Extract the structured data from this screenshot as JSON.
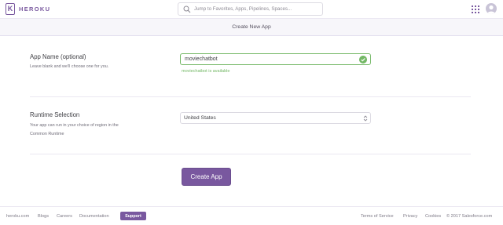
{
  "brand": {
    "name": "HEROKU",
    "logo_letter": "K",
    "color": "#79589f"
  },
  "search": {
    "placeholder": "Jump to Favorites, Apps, Pipelines, Spaces..."
  },
  "subheader": {
    "title": "Create New App"
  },
  "app_name": {
    "title": "App Name (optional)",
    "description": "Leave blank and we'll choose one for you.",
    "value": "moviechatbot",
    "availability": "moviechatbot is available"
  },
  "runtime": {
    "title": "Runtime Selection",
    "description": "Your app can run in your choice of region in the Common Runtime",
    "selected_region": "United States"
  },
  "actions": {
    "create_label": "Create App"
  },
  "footer": {
    "links_left": [
      "heroku.com",
      "Blogs",
      "Careers",
      "Documentation"
    ],
    "support_label": "Support",
    "links_right": [
      "Terms of Service",
      "Privacy",
      "Cookies"
    ],
    "copyright": "© 2017 Salesforce.com"
  },
  "icons": {
    "logo": "heroku-logo-icon",
    "search": "search-icon",
    "apps_grid": "grid-icon",
    "avatar": "user-avatar-icon",
    "valid": "checkmark-icon",
    "select_arrow": "chevron-updown-icon"
  },
  "colors": {
    "accent": "#79589f",
    "success": "#74b866"
  }
}
